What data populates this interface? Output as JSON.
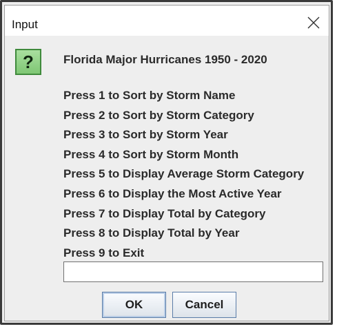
{
  "window": {
    "title": "Input",
    "close_icon": "close-icon"
  },
  "dialog": {
    "icon": "question-icon",
    "icon_glyph": "?",
    "heading": "Florida Major Hurricanes 1950 - 2020",
    "options": [
      "Press 1 to Sort by Storm Name",
      "Press 2 to Sort by Storm Category",
      "Press 3 to Sort by Storm Year",
      "Press 4 to Sort by Storm Month",
      "Press 5 to Display Average Storm Category",
      "Press 6 to Display the Most Active Year",
      "Press 7 to Display Total by Category",
      "Press 8 to Display Total by Year",
      "Press 9 to Exit"
    ],
    "input_value": "",
    "ok_label": "OK",
    "cancel_label": "Cancel"
  },
  "colors": {
    "dialog_background": "#eeeeee",
    "titlebar_background": "#ffffff",
    "icon_green": "#7fc774",
    "button_border": "#5a7ca8"
  }
}
